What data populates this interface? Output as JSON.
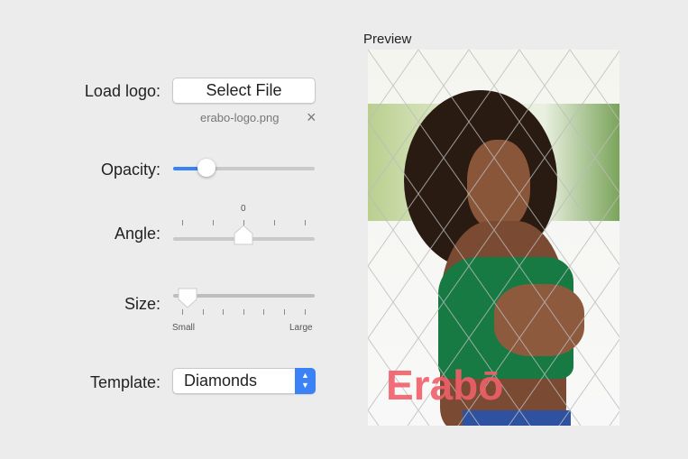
{
  "preview": {
    "label": "Preview",
    "watermark": "Erabō"
  },
  "load_logo": {
    "label": "Load logo:",
    "button": "Select File",
    "filename": "erabo-logo.png",
    "clear": "×"
  },
  "opacity": {
    "label": "Opacity:",
    "value": 0.24
  },
  "angle": {
    "label": "Angle:",
    "value_label": "0",
    "value": 0.5
  },
  "size": {
    "label": "Size:",
    "min_label": "Small",
    "max_label": "Large",
    "value": 0.1
  },
  "template": {
    "label": "Template:",
    "selected": "Diamonds"
  },
  "colors": {
    "accent": "#3b82f6",
    "watermark": "#f0606a"
  }
}
